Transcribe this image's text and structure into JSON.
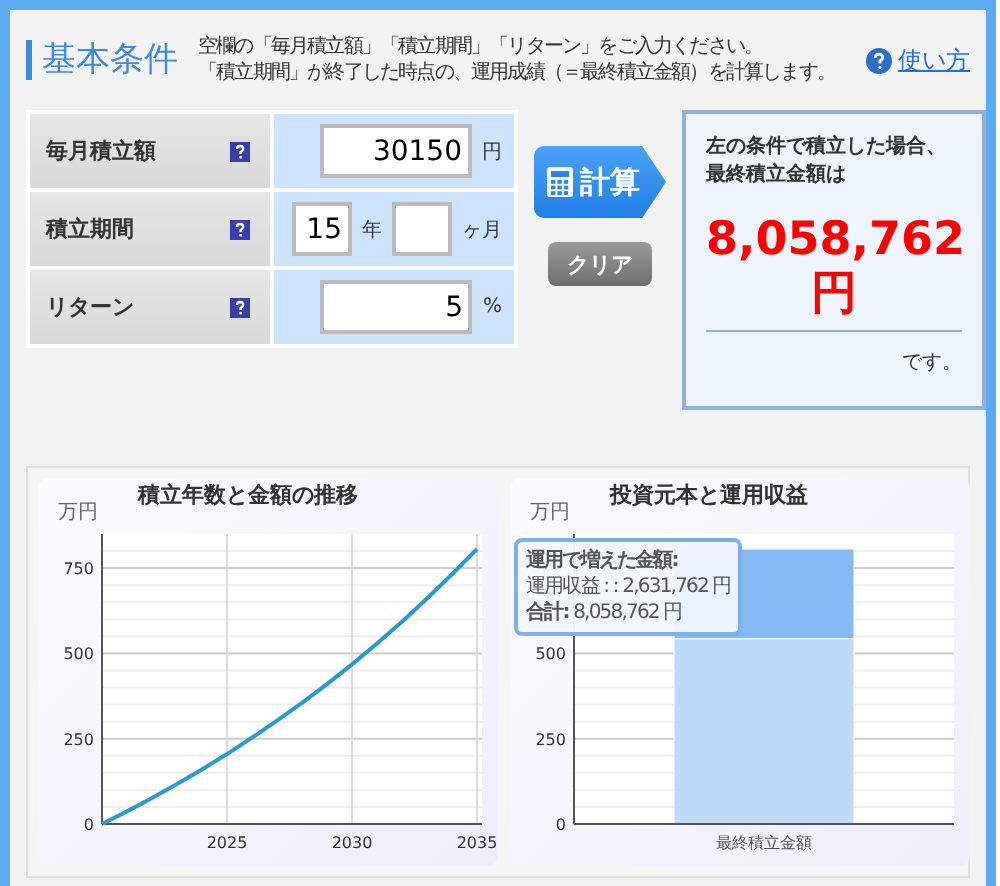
{
  "header": {
    "title": "基本条件",
    "description": [
      "空欄の「毎月積立額」「積立期間」「リターン」をご入力ください。",
      "「積立期間」が終了した時点の、運用成績（＝最終積立金額）を計算します。"
    ],
    "help_link": "使い方"
  },
  "form": {
    "rows": [
      {
        "kind": "single",
        "label": "毎月積立額",
        "fields": [
          {
            "value": "30150",
            "unit": "円"
          }
        ]
      },
      {
        "kind": "double",
        "label": "積立期間",
        "fields": [
          {
            "value": "15",
            "unit": "年"
          },
          {
            "unit": "ヶ月"
          }
        ]
      },
      {
        "kind": "single",
        "label": "リターン",
        "fields": [
          {
            "value": "5",
            "unit": "%"
          }
        ]
      }
    ]
  },
  "calculate_button": "計算",
  "clear_button": "クリア",
  "result": {
    "lead": [
      "左の条件で積立した場合、",
      "最終積立金額は"
    ],
    "amount": "8,058,762",
    "currency": "円",
    "suffix": "です。"
  },
  "charts": [
    {
      "chart_data": {
        "type": "line",
        "title": "積立年数と金額の推移",
        "ylabel": "万円",
        "x": [
          2020,
          2021,
          2022,
          2023,
          2024,
          2025,
          2026,
          2027,
          2028,
          2029,
          2030,
          2031,
          2032,
          2033,
          2034,
          2035
        ],
        "series": [
          {
            "color": "#2a9bc8",
            "values": [
              0,
              37,
              76,
              117,
              160,
              205,
              253,
              303,
              355,
              410,
              468,
              529,
              593,
              661,
              732,
              806
            ]
          }
        ],
        "xlim": [
          2020,
          2035.2
        ],
        "ylim": [
          0,
          850
        ],
        "xticks": [
          2025,
          2030,
          2035
        ],
        "yticks": [
          0,
          250,
          500,
          750
        ],
        "grid": true
      }
    },
    {
      "chart_data": {
        "type": "bar",
        "title": "投資元本と運用収益",
        "ylabel": "万円",
        "categories": [
          "最終積立金額"
        ],
        "series": [
          {
            "color": "#bcd9f7",
            "values": [
              543
            ]
          },
          {
            "color": "#86baf7",
            "values": [
              263
            ]
          }
        ],
        "stacked": true,
        "ylim": [
          0,
          850
        ],
        "yticks": [
          0,
          250,
          500
        ],
        "grid": true
      },
      "tooltip": {
        "title": "運用で増えた金額:",
        "lines": [
          "運用収益 : : 2,631,762 円",
          "**合計:** 8,058,762 円"
        ]
      }
    }
  ]
}
